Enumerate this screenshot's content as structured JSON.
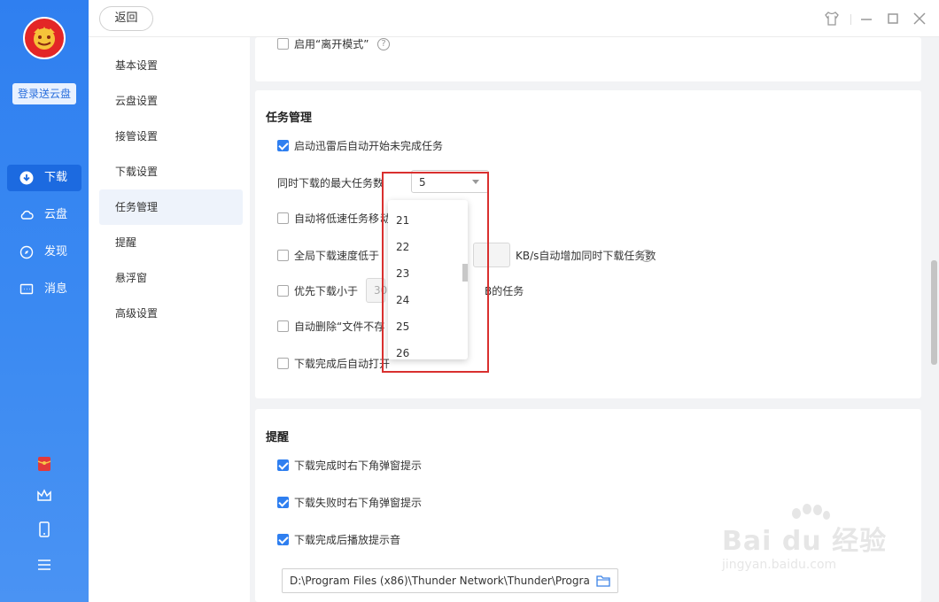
{
  "rail": {
    "promo_label": "登录送云盘",
    "nav": [
      {
        "label": "下载",
        "icon": "download-icon",
        "active": true
      },
      {
        "label": "云盘",
        "icon": "cloud-icon",
        "active": false
      },
      {
        "label": "发现",
        "icon": "discover-icon",
        "active": false
      },
      {
        "label": "消息",
        "icon": "message-icon",
        "active": false
      }
    ],
    "bottom_icons": [
      "red-packet-icon",
      "crown-icon",
      "phone-icon",
      "menu-icon"
    ]
  },
  "topbar": {
    "back_label": "返回",
    "window_icons": [
      "skin-icon",
      "minimize-icon",
      "maximize-icon",
      "close-icon"
    ]
  },
  "sidenav": {
    "items": [
      "基本设置",
      "云盘设置",
      "接管设置",
      "下载设置",
      "任务管理",
      "提醒",
      "悬浮窗",
      "高级设置"
    ],
    "active_index": 4
  },
  "top_card": {
    "offline_mode_label": "启用“离开模式”",
    "offline_mode_checked": false
  },
  "task_section": {
    "title": "任务管理",
    "auto_start_label": "启动迅雷后自动开始未完成任务",
    "auto_start_checked": true,
    "max_tasks_label": "同时下载的最大任务数",
    "max_tasks_value": "5",
    "low_speed_label": "自动将低速任务移",
    "low_speed_suffix": "动",
    "global_speed_prefix": "全局下载速度低于",
    "global_speed_suffix": "KB/s自动增加同时下载任务数",
    "small_first_prefix": "优先下载小于",
    "small_first_value": "30",
    "small_first_suffix": "B的任务",
    "auto_delete_label": "自动删除“文件不存",
    "auto_open_label": "下载完成后自动打开"
  },
  "dropdown": {
    "options": [
      "21",
      "22",
      "23",
      "24",
      "25",
      "26"
    ]
  },
  "reminder_section": {
    "title": "提醒",
    "items": [
      {
        "label": "下载完成时右下角弹窗提示",
        "checked": true
      },
      {
        "label": "下载失败时右下角弹窗提示",
        "checked": true
      },
      {
        "label": "下载完成后播放提示音",
        "checked": true
      }
    ],
    "sound_path": "D:\\Program Files (x86)\\Thunder Network\\Thunder\\Program"
  },
  "watermark": {
    "main": "Bai du 经验",
    "sub": "jingyan.baidu.com"
  }
}
